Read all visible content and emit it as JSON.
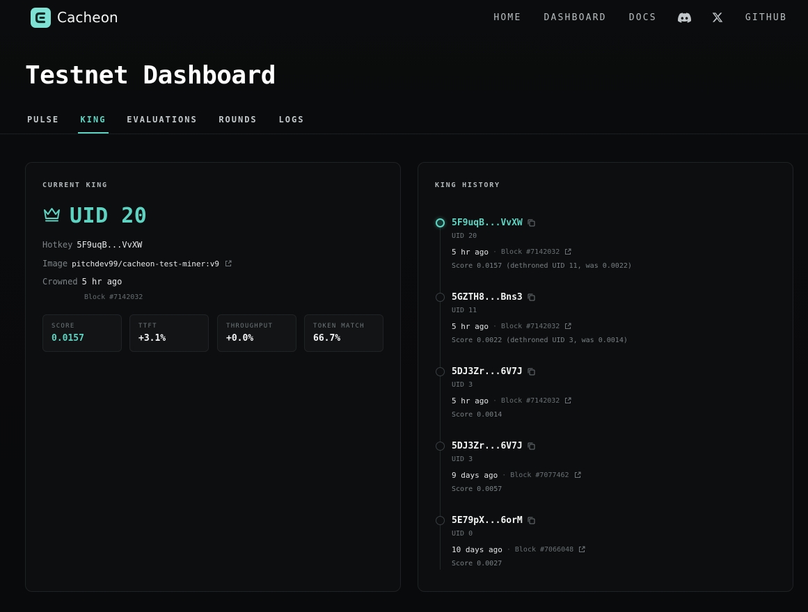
{
  "brand": {
    "name": "Cacheon"
  },
  "nav": {
    "home": "HOME",
    "dashboard": "DASHBOARD",
    "docs": "DOCS",
    "github": "GITHUB",
    "icons": [
      "discord-icon",
      "x-icon"
    ]
  },
  "page": {
    "title": "Testnet Dashboard"
  },
  "tabs": [
    {
      "label": "PULSE",
      "active": false
    },
    {
      "label": "KING",
      "active": true
    },
    {
      "label": "EVALUATIONS",
      "active": false
    },
    {
      "label": "ROUNDS",
      "active": false
    },
    {
      "label": "LOGS",
      "active": false
    }
  ],
  "current_king": {
    "section_label": "CURRENT KING",
    "uid": "UID 20",
    "hotkey_label": "Hotkey",
    "hotkey": "5F9uqB...VvXW",
    "image_label": "Image",
    "image": "pitchdev99/cacheon-test-miner:v9",
    "crowned_label": "Crowned",
    "crowned": "5 hr ago",
    "block": "Block #7142032",
    "stats": [
      {
        "label": "SCORE",
        "value": "0.0157"
      },
      {
        "label": "TTFT",
        "value": "+3.1%"
      },
      {
        "label": "THROUGHPUT",
        "value": "+0.0%"
      },
      {
        "label": "TOKEN MATCH",
        "value": "66.7%"
      }
    ]
  },
  "king_history": {
    "section_label": "KING HISTORY",
    "entries": [
      {
        "hotkey": "5F9uqB...VvXW",
        "uid": "UID 20",
        "when": "5 hr ago",
        "block": "Block #7142032",
        "score": "Score 0.0157 (dethroned UID 11, was 0.0022)",
        "current": true
      },
      {
        "hotkey": "5GZTH8...Bns3",
        "uid": "UID 11",
        "when": "5 hr ago",
        "block": "Block #7142032",
        "score": "Score 0.0022 (dethroned UID 3, was 0.0014)",
        "current": false
      },
      {
        "hotkey": "5DJ3Zr...6V7J",
        "uid": "UID 3",
        "when": "5 hr ago",
        "block": "Block #7142032",
        "score": "Score 0.0014",
        "current": false
      },
      {
        "hotkey": "5DJ3Zr...6V7J",
        "uid": "UID 3",
        "when": "9 days ago",
        "block": "Block #7077462",
        "score": "Score 0.0057",
        "current": false
      },
      {
        "hotkey": "5E79pX...6orM",
        "uid": "UID 0",
        "when": "10 days ago",
        "block": "Block #7066048",
        "score": "Score 0.0027",
        "current": false
      }
    ],
    "separator": "·"
  },
  "colors": {
    "accent": "#5fd3c1",
    "background": "#090a0b",
    "card": "#0d0e0f",
    "logo": "#7fe1d4"
  }
}
